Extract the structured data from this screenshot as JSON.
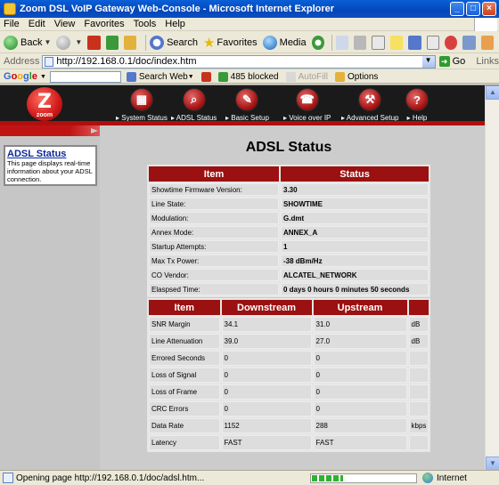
{
  "window": {
    "title": "Zoom DSL VoIP Gateway Web-Console - Microsoft Internet Explorer"
  },
  "menu": [
    "File",
    "Edit",
    "View",
    "Favorites",
    "Tools",
    "Help"
  ],
  "toolbar": {
    "back": "Back",
    "search": "Search",
    "favorites": "Favorites",
    "media": "Media"
  },
  "address": {
    "label": "Address",
    "url": "http://192.168.0.1/doc/index.htm",
    "go": "Go",
    "links": "Links"
  },
  "googlebar": {
    "logo": [
      "G",
      "o",
      "o",
      "g",
      "l",
      "e"
    ],
    "search_web": "Search Web",
    "blocked": "485 blocked",
    "autofill": "AutoFill",
    "options": "Options"
  },
  "zoom": {
    "brand": "zoom",
    "nav": [
      {
        "label": "System Status",
        "icon": "server-icon",
        "glyph": "▦"
      },
      {
        "label": "ADSL Status",
        "icon": "magnifier-icon",
        "glyph": "⌕"
      },
      {
        "label": "Basic Setup",
        "icon": "wrench-icon",
        "glyph": "✎"
      },
      {
        "label": "Voice over IP",
        "icon": "phone-icon",
        "glyph": "☎"
      },
      {
        "label": "Advanced Setup",
        "icon": "tools-icon",
        "glyph": "⚒"
      },
      {
        "label": "Help",
        "icon": "help-icon",
        "glyph": "?"
      }
    ]
  },
  "sidebar": {
    "heading": "ADSL Status",
    "text": "This page displays real-time information about your ADSL connection."
  },
  "page": {
    "title": "ADSL Status"
  },
  "status_table": {
    "headers": [
      "Item",
      "Status"
    ],
    "rows": [
      [
        "Showtime Firmware Version:",
        "3.30"
      ],
      [
        "Line State:",
        "SHOWTIME"
      ],
      [
        "Modulation:",
        "G.dmt"
      ],
      [
        "Annex Mode:",
        "ANNEX_A"
      ],
      [
        "Startup Attempts:",
        "1"
      ],
      [
        "Max Tx Power:",
        "-38 dBm/Hz"
      ],
      [
        "CO Vendor:",
        "ALCATEL_NETWORK"
      ],
      [
        "Elaspsed Time:",
        "0 days 0 hours 0 minutes 50 seconds"
      ]
    ]
  },
  "stats_table": {
    "headers": [
      "Item",
      "Downstream",
      "Upstream",
      ""
    ],
    "rows": [
      [
        "SNR Margin",
        "34.1",
        "31.0",
        "dB"
      ],
      [
        "Line Attenuation",
        "39.0",
        "27.0",
        "dB"
      ],
      [
        "Errored Seconds",
        "0",
        "0",
        ""
      ],
      [
        "Loss of Signal",
        "0",
        "0",
        ""
      ],
      [
        "Loss of Frame",
        "0",
        "0",
        ""
      ],
      [
        "CRC Errors",
        "0",
        "0",
        ""
      ],
      [
        "Data Rate",
        "1152",
        "288",
        "kbps"
      ],
      [
        "Latency",
        "FAST",
        "FAST",
        ""
      ]
    ]
  },
  "statusbar": {
    "text": "Opening page http://192.168.0.1/doc/adsl.htm...",
    "zone": "Internet",
    "progress": 0.3
  }
}
